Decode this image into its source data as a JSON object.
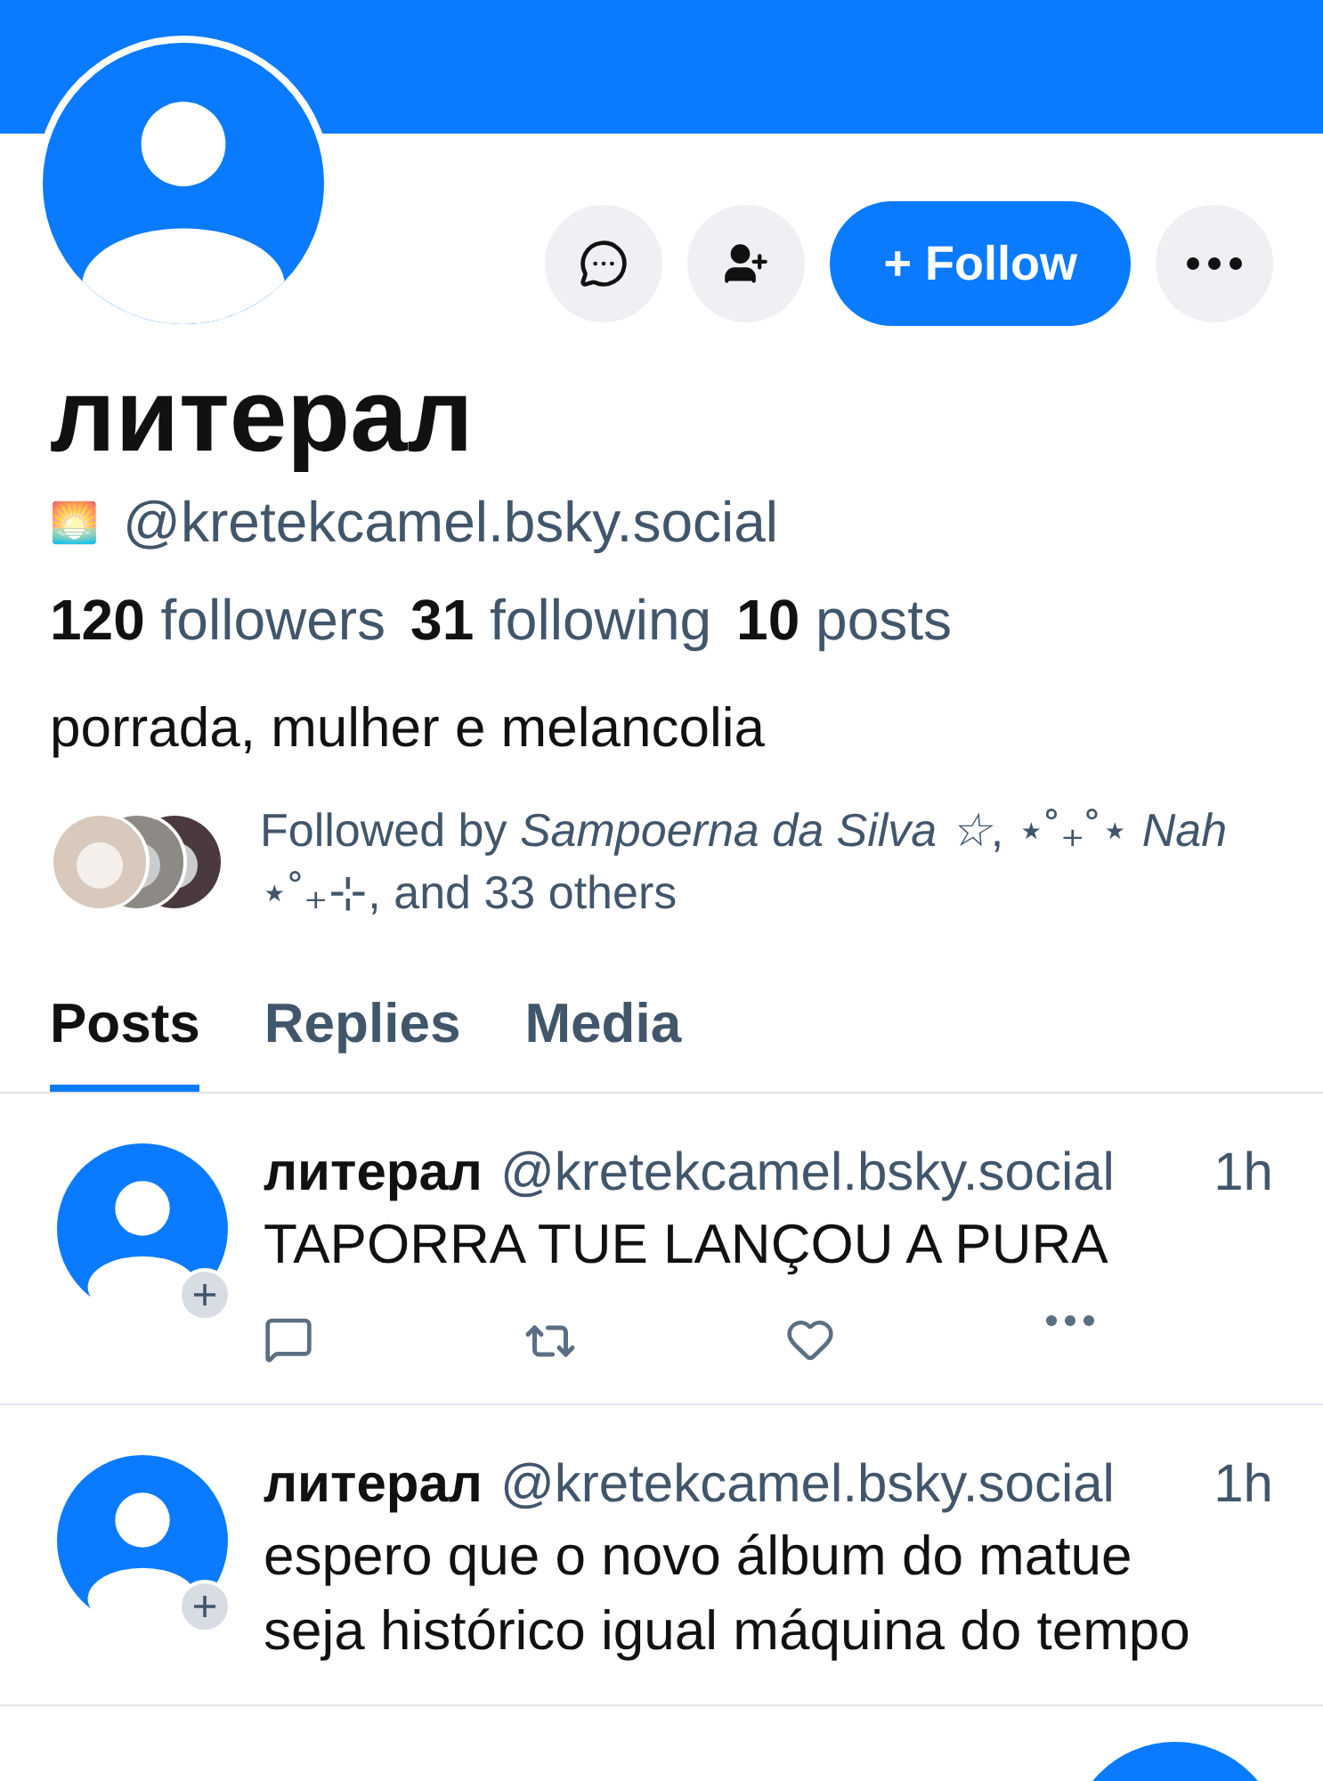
{
  "profile": {
    "display_name": "литерал",
    "handle_emoji": "🌅",
    "handle": "@kretekcamel.bsky.social",
    "stats": [
      "**120** followers",
      "**31** following",
      "**10** posts"
    ],
    "bio": "porrada, mulher e melancolia",
    "followed_by": "Followed by *Sampoerna da Silva ☆*, ⋆˚₊˚⋆ *Nah* ⋆˚₊⊹, and 33 others"
  },
  "actions": [
    {
      "kind": "message"
    },
    {
      "kind": "add-user"
    },
    {
      "kind": "follow",
      "label": "+ Follow"
    },
    {
      "kind": "more"
    }
  ],
  "tabs": [
    {
      "label": "Posts",
      "selected": true
    },
    {
      "label": "Replies",
      "selected": false
    },
    {
      "label": "Media",
      "selected": false
    }
  ],
  "posts": [
    {
      "author": "литерал",
      "handle": "@kretekcamel.bsky.social",
      "time": "1h",
      "text": "TAPORRA TUE LANÇOU A PURA",
      "show_actions": true
    },
    {
      "author": "литерал",
      "handle": "@kretekcamel.bsky.social",
      "time": "1h",
      "text": "espero que o novo álbum do matue seja histórico igual máquina do tempo",
      "show_actions": false
    }
  ]
}
